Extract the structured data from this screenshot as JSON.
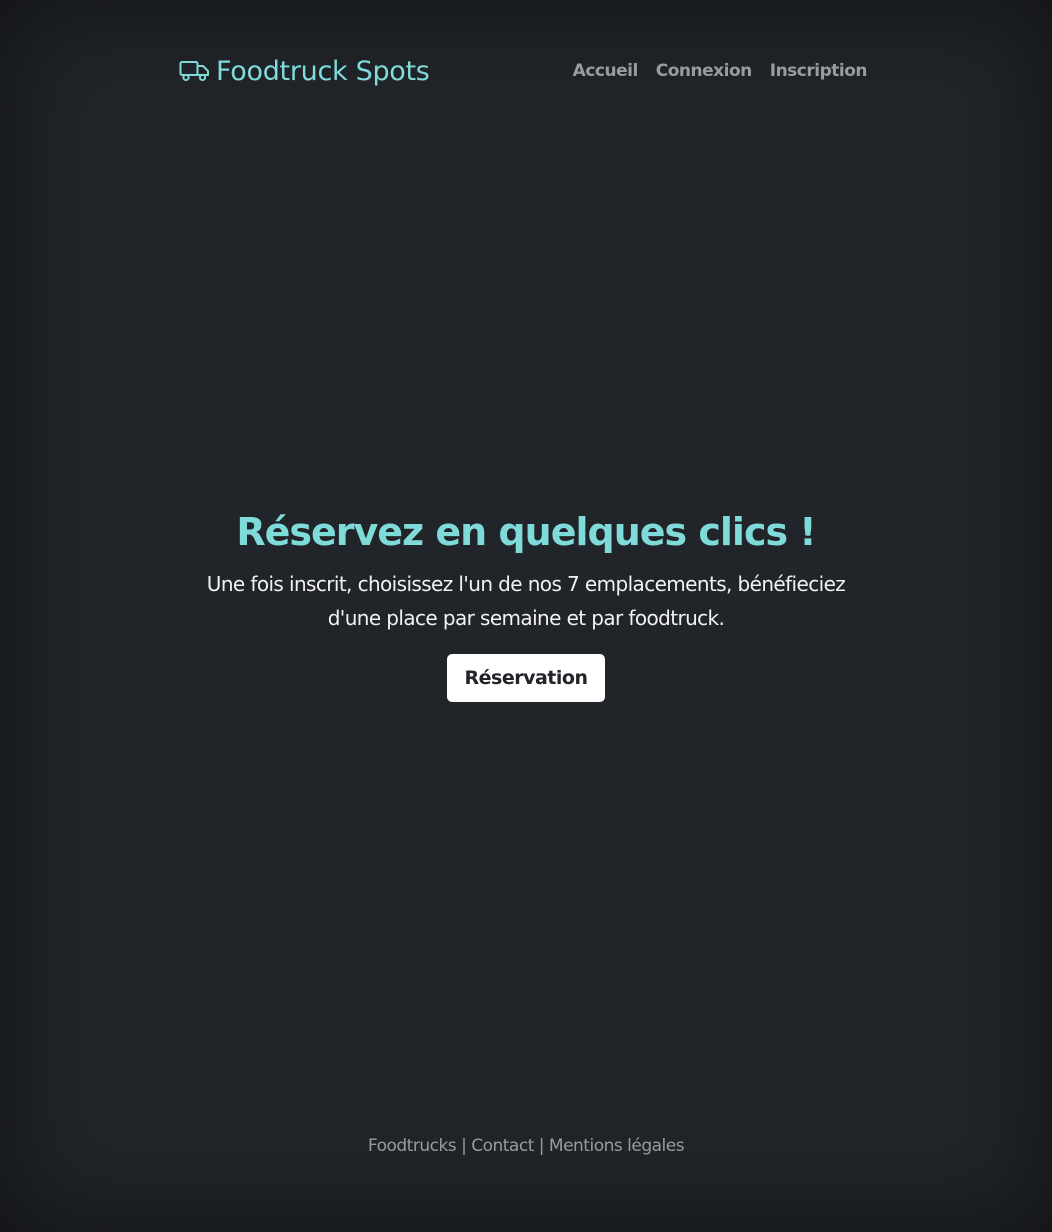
{
  "header": {
    "brand_icon": "truck-icon",
    "brand_title": "Foodtruck Spots",
    "brand_color": "#7fdbda",
    "nav": [
      {
        "label": "Accueil"
      },
      {
        "label": "Connexion"
      },
      {
        "label": "Inscription"
      }
    ]
  },
  "hero": {
    "title": "Réservez en quelques clics !",
    "text": "Une fois inscrit, choisissez l'un de nos 7 emplacements, bénéfieciez d'une place par semaine et par foodtruck.",
    "button_label": "Réservation"
  },
  "footer": {
    "links": [
      {
        "label": "Foodtrucks"
      },
      {
        "label": "Contact"
      },
      {
        "label": "Mentions légales"
      }
    ],
    "separator": "|"
  },
  "colors": {
    "background": "#212428",
    "accent": "#7fdbda",
    "nav_text": "#9a9b9d"
  }
}
